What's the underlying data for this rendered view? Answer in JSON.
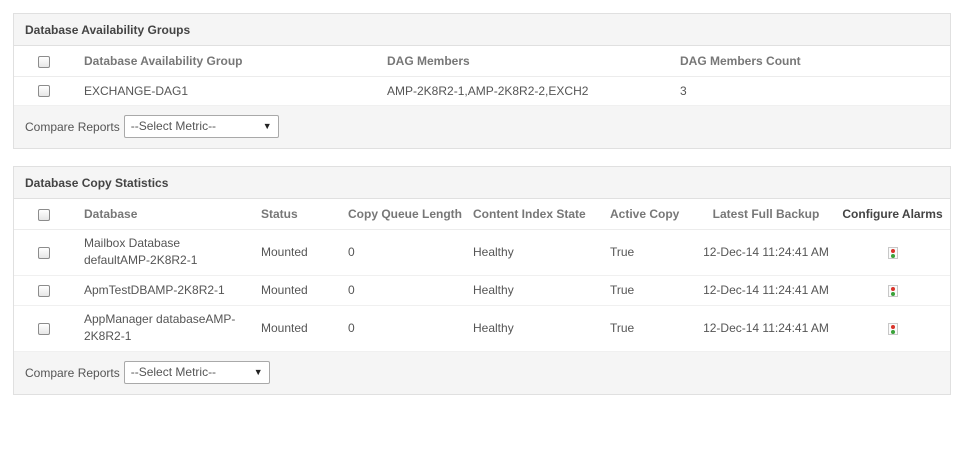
{
  "dag_panel": {
    "title": "Database Availability Groups",
    "columns": [
      "Database Availability Group",
      "DAG Members",
      "DAG Members Count"
    ],
    "rows": [
      {
        "group": "EXCHANGE-DAG1",
        "members": "AMP-2K8R2-1,AMP-2K8R2-2,EXCH2",
        "count": "3"
      }
    ],
    "compare_label": "Compare Reports",
    "select_value": "--Select Metric--"
  },
  "copy_panel": {
    "title": "Database Copy Statistics",
    "columns": [
      "Database",
      "Status",
      "Copy Queue Length",
      "Content Index State",
      "Active Copy",
      "Latest Full Backup",
      "Configure Alarms"
    ],
    "rows": [
      {
        "database": "Mailbox Database defaultAMP-2K8R2-1",
        "status": "Mounted",
        "queue": "0",
        "index_state": "Healthy",
        "active": "True",
        "backup": "12-Dec-14 11:24:41 AM"
      },
      {
        "database": "ApmTestDBAMP-2K8R2-1",
        "status": "Mounted",
        "queue": "0",
        "index_state": "Healthy",
        "active": "True",
        "backup": "12-Dec-14 11:24:41 AM"
      },
      {
        "database": "AppManager databaseAMP-2K8R2-1",
        "status": "Mounted",
        "queue": "0",
        "index_state": "Healthy",
        "active": "True",
        "backup": "12-Dec-14 11:24:41 AM"
      }
    ],
    "compare_label": "Compare Reports",
    "select_value": "--Select Metric--"
  },
  "icons": {
    "select_arrow": "triangle-down-icon",
    "alarm": "alarm-config-icon"
  },
  "colors": {
    "alarm_red": "#d9332a",
    "alarm_green": "#3aa23a"
  }
}
